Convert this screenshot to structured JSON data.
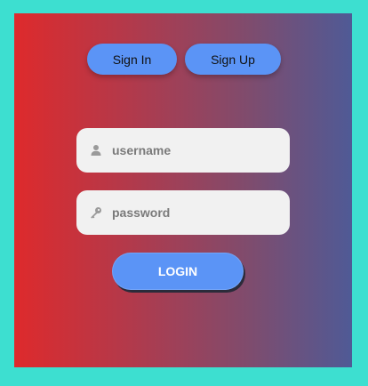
{
  "tabs": {
    "sign_in": "Sign In",
    "sign_up": "Sign Up"
  },
  "form": {
    "username_placeholder": "username",
    "username_value": "",
    "password_placeholder": "password",
    "password_value": "",
    "login_label": "LOGIN"
  },
  "icons": {
    "username": "user-icon",
    "password": "key-icon"
  },
  "colors": {
    "page_background": "#3ddfd0",
    "gradient_left": "#de2a2c",
    "gradient_right": "#4f5a96",
    "button": "#5b94f6",
    "field": "#f1f1f1"
  }
}
